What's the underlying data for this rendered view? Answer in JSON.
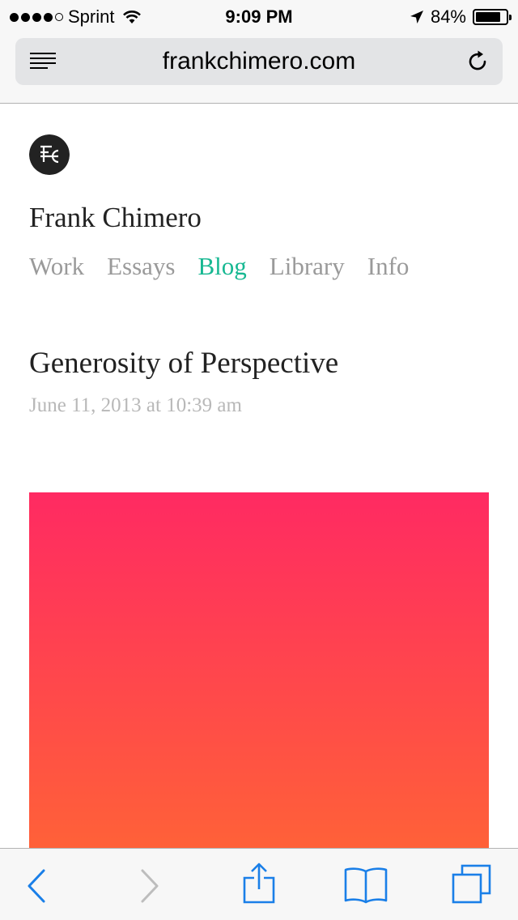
{
  "status_bar": {
    "carrier": "Sprint",
    "time": "9:09 PM",
    "battery_percent": "84%",
    "battery_level": 0.84,
    "signal_bars_filled": 4,
    "signal_bars_total": 5
  },
  "browser": {
    "url": "frankchimero.com"
  },
  "site": {
    "logo_letters": "FC",
    "title": "Frank Chimero",
    "nav": [
      {
        "label": "Work"
      },
      {
        "label": "Essays"
      },
      {
        "label": "Blog"
      },
      {
        "label": "Library"
      },
      {
        "label": "Info"
      }
    ],
    "active_nav": "Blog",
    "accent_color": "#17b892"
  },
  "post": {
    "title": "Generosity of Perspective",
    "date": "June 11, 2013 at 10:39 am",
    "image_colors": [
      "#ff2a62",
      "#ff6138"
    ]
  },
  "toolbar": {
    "accent_color": "#1a7fe8",
    "icons": [
      "back-arrow-icon",
      "forward-arrow-icon",
      "share-icon",
      "bookmarks-icon",
      "tabs-icon"
    ]
  }
}
